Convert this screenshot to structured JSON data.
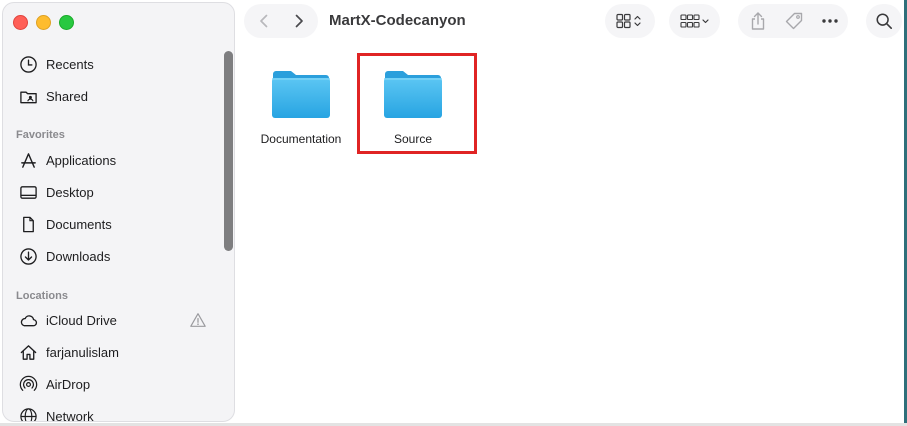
{
  "window": {
    "title": "MartX-Codecanyon"
  },
  "sidebar": {
    "top_items": [
      {
        "label": "Recents",
        "icon": "clock-icon"
      },
      {
        "label": "Shared",
        "icon": "shared-folder-icon"
      }
    ],
    "favorites_header": "Favorites",
    "favorites": [
      {
        "label": "Applications",
        "icon": "applications-icon"
      },
      {
        "label": "Desktop",
        "icon": "desktop-icon"
      },
      {
        "label": "Documents",
        "icon": "document-icon"
      },
      {
        "label": "Downloads",
        "icon": "download-icon"
      }
    ],
    "locations_header": "Locations",
    "locations": [
      {
        "label": "iCloud Drive",
        "icon": "cloud-icon",
        "status_icon": "warning-icon"
      },
      {
        "label": "farjanulislam",
        "icon": "home-icon"
      },
      {
        "label": "AirDrop",
        "icon": "airdrop-icon"
      },
      {
        "label": "Network",
        "icon": "network-icon"
      }
    ]
  },
  "toolbar": {
    "back_icon": "chevron-left-icon",
    "forward_icon": "chevron-right-icon",
    "view_icon": "grid-view-icon",
    "group_icon": "group-by-icon",
    "share_icon": "share-icon",
    "tag_icon": "tag-icon",
    "more_icon": "more-icon",
    "search_icon": "search-icon"
  },
  "content": {
    "items": [
      {
        "label": "Documentation",
        "icon": "folder-icon"
      },
      {
        "label": "Source",
        "icon": "folder-icon",
        "highlighted": true
      }
    ],
    "highlight_color": "#e02424",
    "folder_color": "#3fb4ec"
  }
}
